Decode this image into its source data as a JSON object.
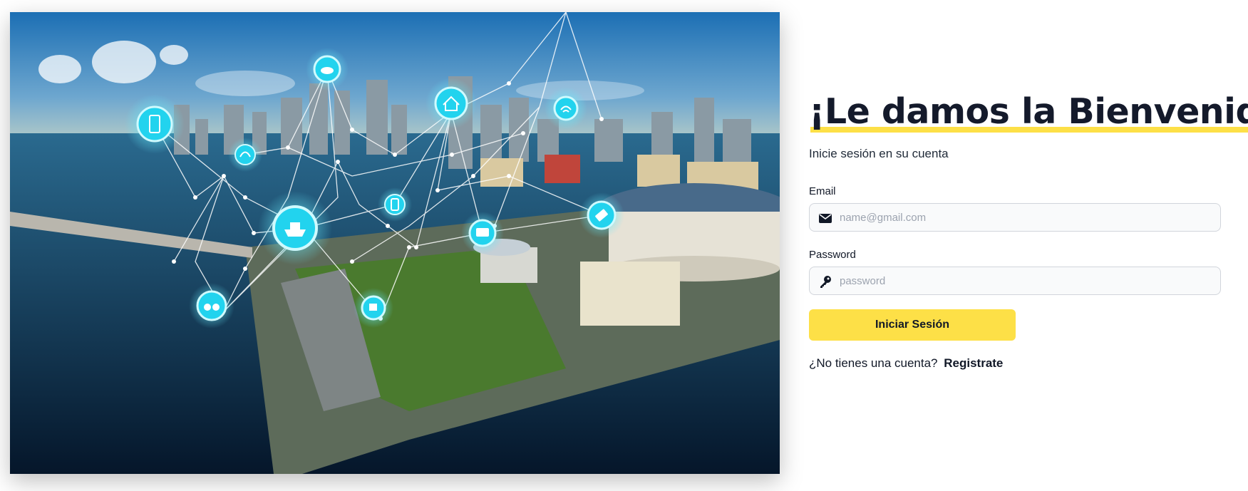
{
  "hero": {
    "sky_top": "#1c6fb4",
    "water": "#0c2f4c",
    "node_color": "#22d3ee",
    "icons": [
      "phone-icon",
      "cloud-icon",
      "home-icon",
      "wifi-icon",
      "headset-icon",
      "mobile-icon",
      "ship-icon",
      "train-icon",
      "ticket-icon",
      "binoculars-icon",
      "cup-icon"
    ]
  },
  "login": {
    "title": "¡Le damos la Bienvenida!",
    "subtitle": "Inicie sesión en su cuenta",
    "email_label": "Email",
    "email_placeholder": "name@gmail.com",
    "email_value": "",
    "password_label": "Password",
    "password_placeholder": "password",
    "password_value": "",
    "submit_label": "Iniciar Sesión",
    "signup_prompt": "¿No tienes una cuenta?",
    "signup_link": "Registrate",
    "accent_color": "#fde047"
  }
}
